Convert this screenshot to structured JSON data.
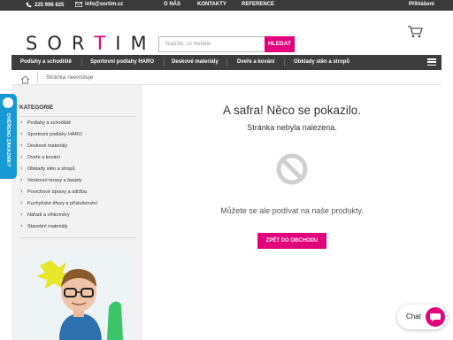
{
  "topbar": {
    "phone": "225 996 825",
    "email": "info@sortim.cz",
    "links": [
      "O NÁS",
      "KONTAKTY",
      "REFERENCE"
    ],
    "login": "Přihlášení",
    "phone_icon": "phone-icon",
    "email_icon": "email-icon"
  },
  "header": {
    "logo_parts": [
      "SOR",
      "T",
      "IM"
    ],
    "search_placeholder": "Napište, co hledáte",
    "search_button": "HLEDAT",
    "cart_icon": "cart-icon"
  },
  "nav": {
    "items": [
      "Podlahy a schodiště",
      "Sportovní podlahy HARO",
      "Deskové materiály",
      "Dveře a kování",
      "Obklady stěn a stropů"
    ],
    "menu_icon": "hamburger-icon"
  },
  "breadcrumb": {
    "home_icon": "home-icon",
    "current": "Stránka neexistuje"
  },
  "sidebar": {
    "title": "KATEGORIE",
    "categories": [
      "Podlahy a schodiště",
      "Sportovní podlahy HARO",
      "Deskové materiály",
      "Dveře a kování",
      "Obklady stěn a stropů",
      "Venkovní terasy a fasády",
      "Povrchové úpravy a údržba",
      "Kuchyňské dřezy a příslušenství",
      "Nářadí a vlhkoměry",
      "Stavební materiály"
    ]
  },
  "verify_tab": {
    "label": "OVĚŘENO ZÁKAZNÍKY"
  },
  "main": {
    "title": "A safra! Něco se pokazilo.",
    "subtitle": "Stránka nebyla nalezena.",
    "icon": "no-entry-icon",
    "hint": "Můžete se ale podívat na naše produkty.",
    "button": "ZPĚT DO OBCHODU"
  },
  "chat": {
    "label": "Chat",
    "icon": "chat-bubble-icon"
  },
  "colors": {
    "accent": "#e2007a",
    "dark_bar": "#3a3a3a",
    "verify_blue": "#1799d3",
    "sidebar_bg": "#f2f2f2"
  }
}
